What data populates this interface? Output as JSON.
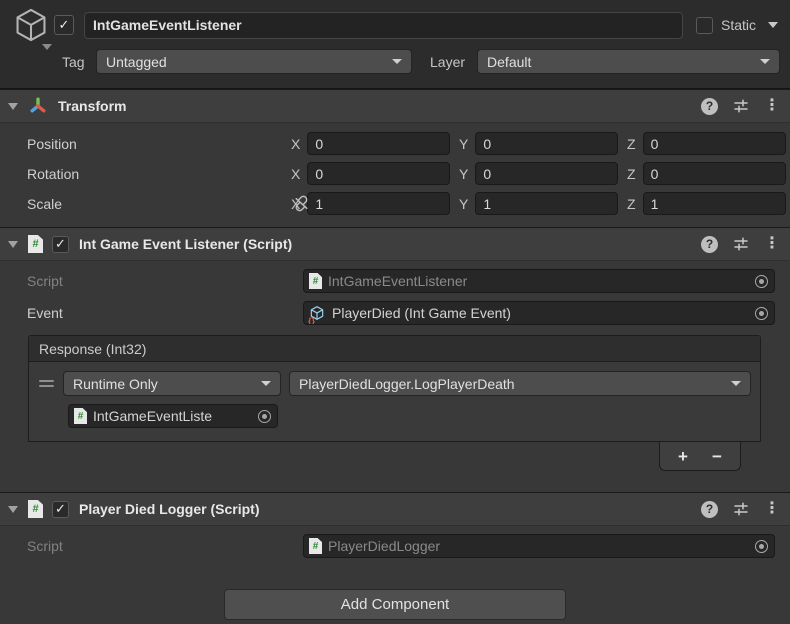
{
  "header": {
    "name_value": "IntGameEventListener",
    "active_checked": true,
    "static_label": "Static",
    "static_checked": false,
    "tag_label": "Tag",
    "tag_value": "Untagged",
    "layer_label": "Layer",
    "layer_value": "Default"
  },
  "transform": {
    "title": "Transform",
    "axis_labels": [
      "X",
      "Y",
      "Z"
    ],
    "rows": [
      {
        "label": "Position",
        "x": "0",
        "y": "0",
        "z": "0",
        "linked": false
      },
      {
        "label": "Rotation",
        "x": "0",
        "y": "0",
        "z": "0",
        "linked": false
      },
      {
        "label": "Scale",
        "x": "1",
        "y": "1",
        "z": "1",
        "linked": true
      }
    ]
  },
  "event_listener": {
    "title": "Int Game Event Listener (Script)",
    "enabled_checked": true,
    "script_label": "Script",
    "script_value": "IntGameEventListener",
    "event_label": "Event",
    "event_value": "PlayerDied (Int Game Event)",
    "response": {
      "header": "Response (Int32)",
      "mode": "Runtime Only",
      "function": "PlayerDiedLogger.LogPlayerDeath",
      "target": "IntGameEventListe",
      "add_label": "+",
      "remove_label": "−"
    }
  },
  "player_died_logger": {
    "title": "Player Died Logger (Script)",
    "enabled_checked": true,
    "script_label": "Script",
    "script_value": "PlayerDiedLogger"
  },
  "footer": {
    "add_component_label": "Add Component"
  },
  "colors": {
    "inspector_bg": "#383838",
    "gameobject_header_bg": "#2c2c2c",
    "component_header_bg": "#3e3e3e",
    "field_bg": "#272727",
    "dropdown_bg": "#4d4d4d",
    "axis_icon_green": "#77c14c",
    "axis_icon_blue": "#53a3dd",
    "axis_icon_red": "#e2574c",
    "script_icon_green": "#2e8b33",
    "scriptable_object_blue": "#9ccde8",
    "scriptable_object_orange": "#e2573f"
  },
  "check_glyph": "✓",
  "kebab_glyph": "⋮",
  "help_glyph": "?"
}
